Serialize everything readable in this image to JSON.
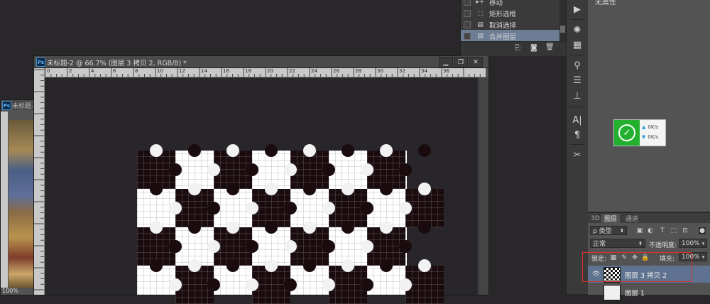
{
  "history": {
    "items": [
      {
        "label": "移动",
        "icon": "move-tool-icon",
        "glyph": "▸+"
      },
      {
        "label": "矩形选框",
        "icon": "rect-marquee-icon",
        "glyph": "⬚"
      },
      {
        "label": "取消选择",
        "icon": "document-icon",
        "glyph": "▤"
      },
      {
        "label": "合并图层",
        "icon": "document-icon",
        "glyph": "▤",
        "selected": true
      }
    ],
    "buttons": [
      {
        "name": "new-doc-from-state-icon",
        "glyph": "⎘"
      },
      {
        "name": "snapshot-camera-icon",
        "glyph": "◙"
      },
      {
        "name": "trash-icon",
        "glyph": "🗑"
      }
    ]
  },
  "properties": {
    "title": "无属性"
  },
  "netspeed": {
    "up": "0K/s",
    "down": "0K/s"
  },
  "document": {
    "title": "未标题-2 @ 66.7% (图层 3 拷贝 2, RGB/8) *",
    "ps_logo": "Ps",
    "ruler_labels": [
      "0",
      "2",
      "4",
      "6",
      "8",
      "10",
      "12",
      "14",
      "16",
      "18",
      "20",
      "22",
      "24",
      "26",
      "28",
      "30",
      "32",
      "34",
      "36"
    ],
    "window_buttons": [
      "▁",
      "❐",
      "✕"
    ]
  },
  "back_document": {
    "title": "未标题-",
    "zoom": "100%"
  },
  "layers": {
    "tabs": [
      {
        "label": "3D",
        "active": false
      },
      {
        "label": "图层",
        "active": true
      },
      {
        "label": "通道",
        "active": false
      }
    ],
    "filter_kind": "ρ 类型",
    "blend_mode": "正常",
    "opacity_label": "不透明度:",
    "opacity_value": "100%",
    "lock_label": "锁定:",
    "fill_label": "填充:",
    "fill_value": "100%",
    "items": [
      {
        "name": "图层 3 拷贝 2",
        "selected": true,
        "visible": true
      },
      {
        "name": "图层 1",
        "selected": false,
        "visible": false
      }
    ]
  },
  "colors": {
    "accent_selected": "#5f7290",
    "highlight_box": "#d9302a",
    "puzzle_dark": "#1a0c0e",
    "net_green": "#23b02f"
  }
}
